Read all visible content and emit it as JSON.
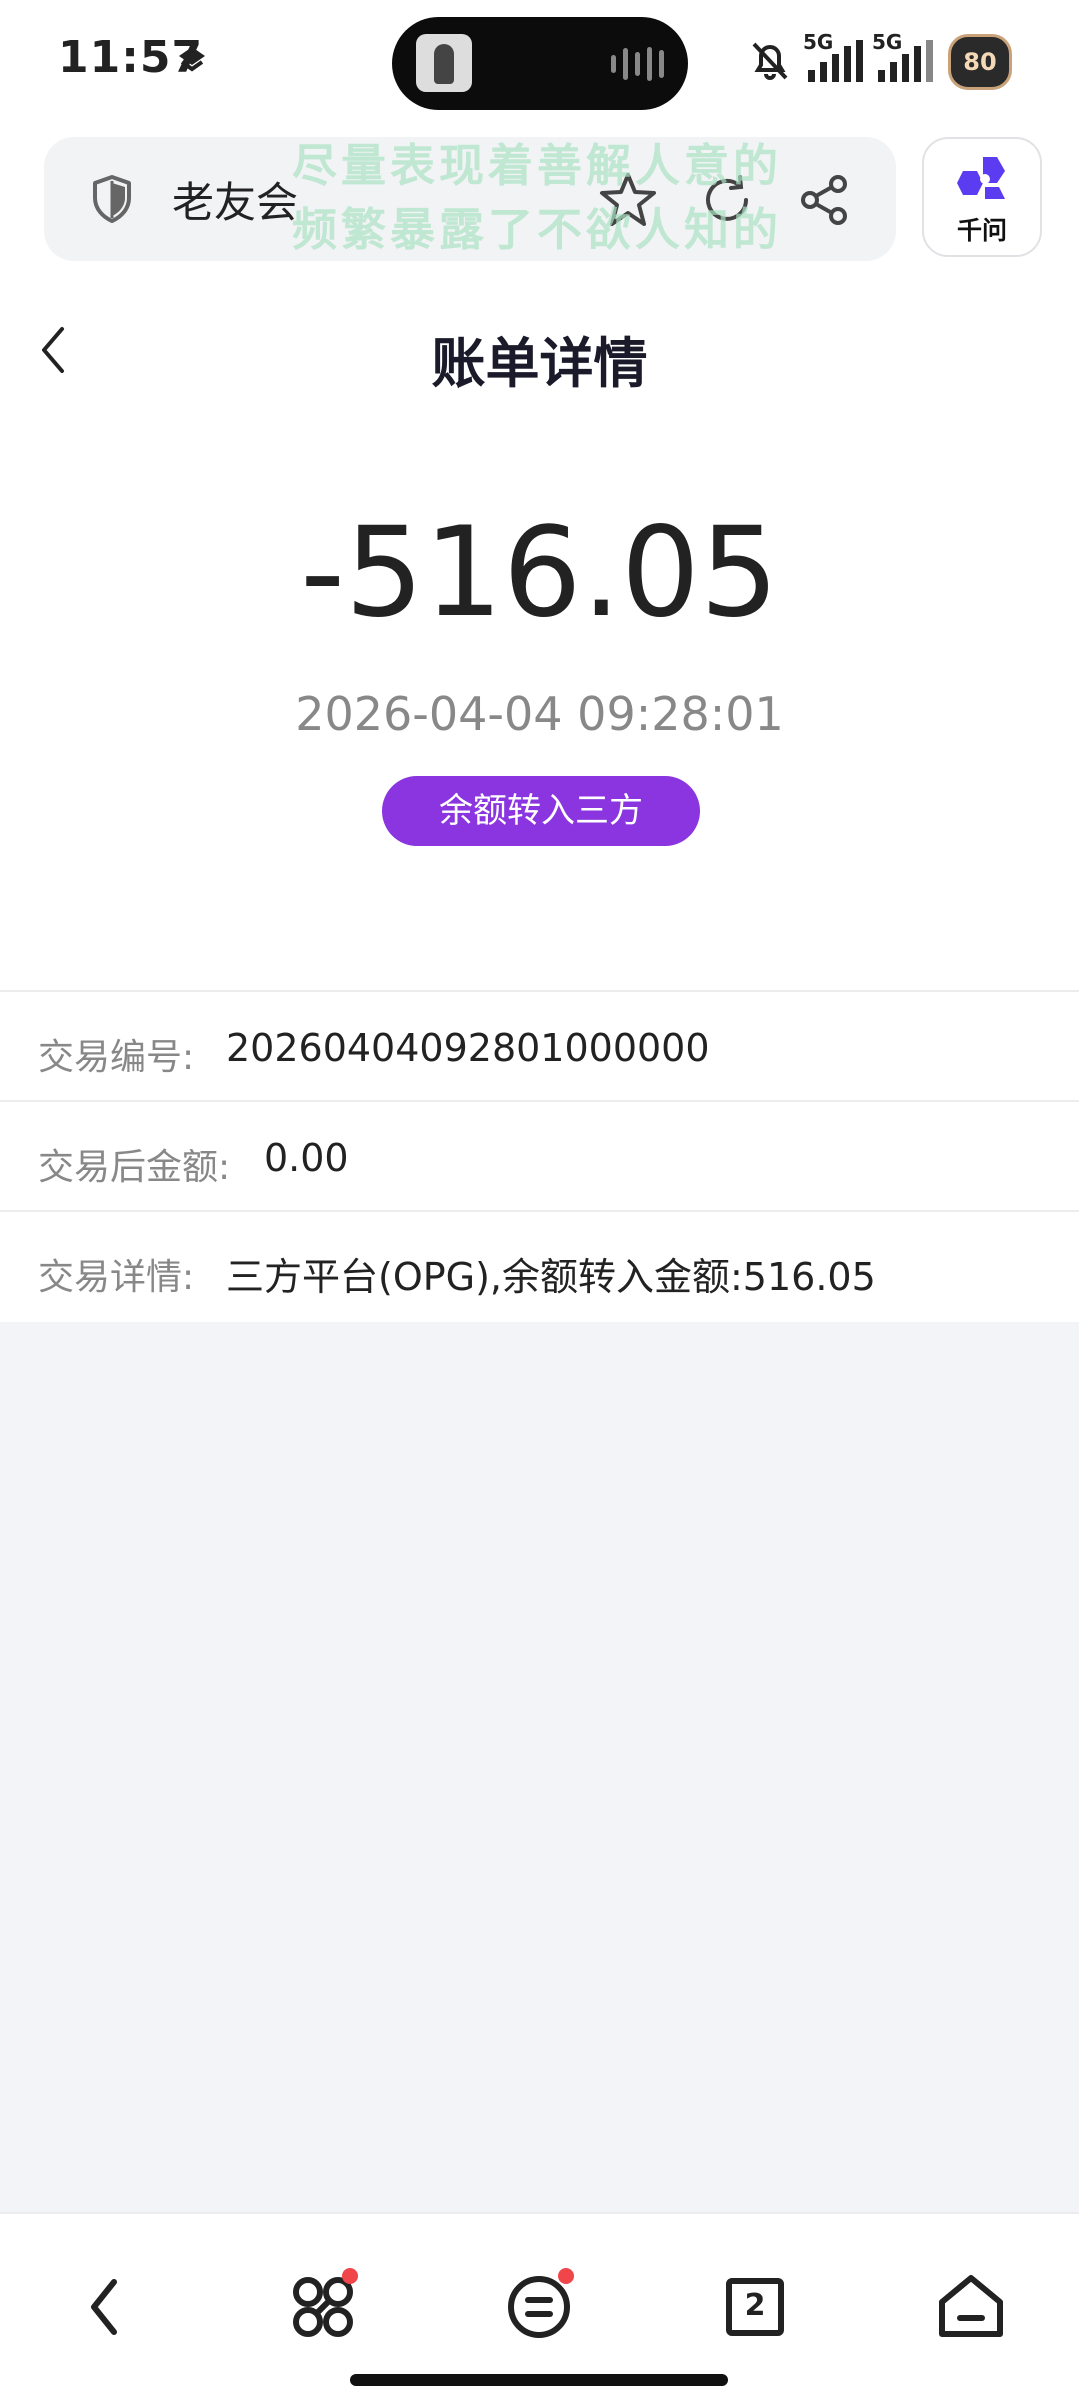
{
  "status_bar": {
    "time": "11:57",
    "network_1": "5G",
    "network_2": "5G",
    "battery": "80",
    "icons": [
      "layers-icon",
      "mute-bell-icon",
      "signal-icon",
      "battery-icon"
    ]
  },
  "browser": {
    "site_title": "老友会",
    "overlay_line1": "尽量表现着善解人意的",
    "overlay_line2": "频繁暴露了不欲人知的",
    "ai_label": "千问",
    "icons": [
      "shield-icon",
      "star-icon",
      "refresh-icon",
      "share-icon"
    ]
  },
  "page": {
    "title": "账单详情",
    "amount": "-516.05",
    "datetime": "2026-04-04 09:28:01",
    "tag": "余额转入三方",
    "details": [
      {
        "label": "交易编号:",
        "value": "20260404092801000000"
      },
      {
        "label": "交易后金额:",
        "value": "0.00"
      },
      {
        "label": "交易详情:",
        "value": "三方平台(OPG),余额转入金额:516.05"
      }
    ]
  },
  "bottom_nav": {
    "items": [
      "back-icon",
      "apps-icon",
      "menu-icon",
      "tabs-icon",
      "home-icon"
    ],
    "tab_count": "2"
  },
  "colors": {
    "accent": "#8a35e0",
    "ai_brand": "#5b3cf0",
    "badge": "#f0464a",
    "background": "#f3f4f8"
  }
}
